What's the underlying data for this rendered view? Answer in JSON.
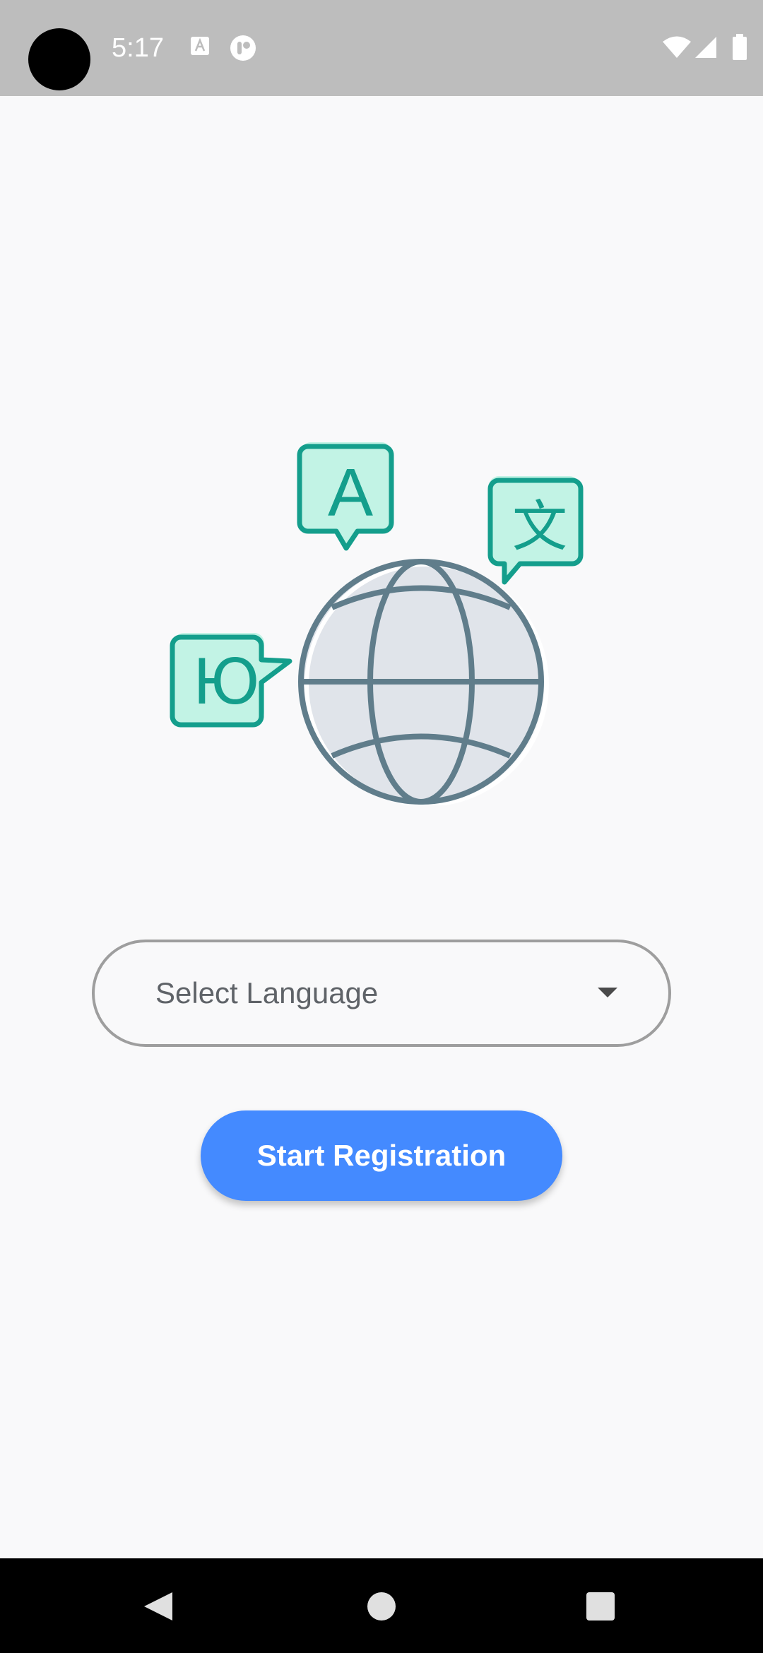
{
  "status_bar": {
    "time": "5:17",
    "icons": [
      "camera-cutout",
      "text-a-notification-icon",
      "app-notification-icon",
      "wifi-icon",
      "cellular-signal-icon",
      "battery-icon"
    ]
  },
  "illustration": {
    "glyph_a": "A",
    "glyph_wen": "文",
    "glyph_yu": "Ю",
    "colors": {
      "bubble_stroke": "#149e8c",
      "bubble_fill": "#c2f3e5",
      "globe_stroke": "#607d8b",
      "globe_fill": "#e0e4ea"
    }
  },
  "language_select": {
    "label": "Select Language",
    "icon": "dropdown-arrow-icon"
  },
  "start_button": {
    "label": "Start Registration",
    "color": "#448aff"
  },
  "nav_bar": {
    "icons": [
      "back-icon",
      "home-icon",
      "recents-icon"
    ]
  }
}
